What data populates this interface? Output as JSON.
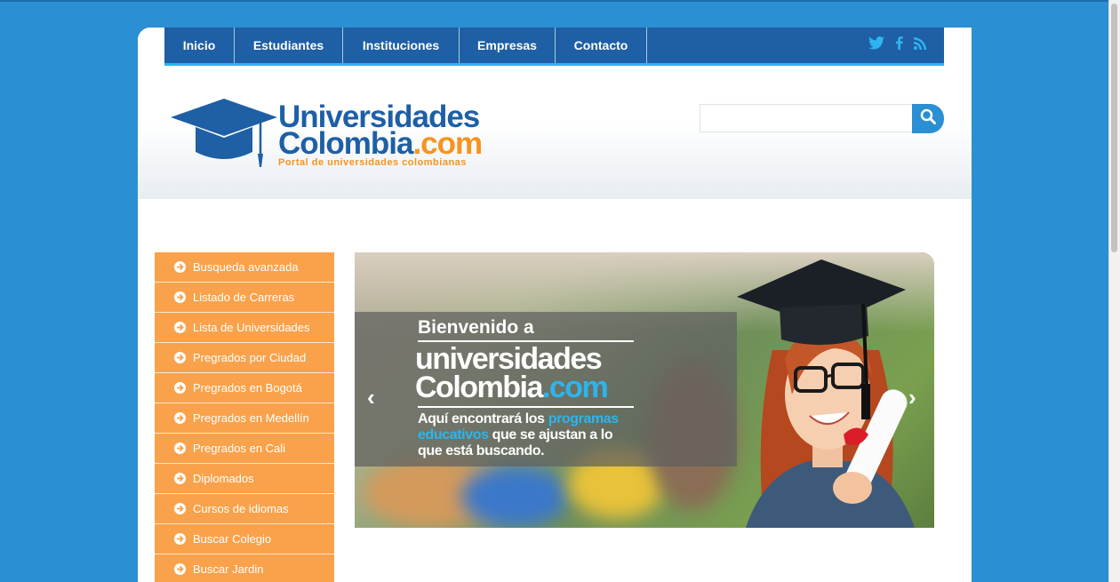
{
  "nav": {
    "items": [
      {
        "label": "Inicio"
      },
      {
        "label": "Estudiantes"
      },
      {
        "label": "Instituciones"
      },
      {
        "label": "Empresas"
      },
      {
        "label": "Contacto"
      }
    ],
    "social": [
      "twitter-icon",
      "facebook-icon",
      "rss-icon"
    ]
  },
  "logo": {
    "line1": "Universidades",
    "line2_main": "Colombia",
    "line2_domain": ".com",
    "tagline": "Portal de universidades colombianas"
  },
  "search": {
    "value": "",
    "placeholder": ""
  },
  "sidebar": {
    "items": [
      {
        "label": "Busqueda avanzada"
      },
      {
        "label": "Listado de Carreras"
      },
      {
        "label": "Lista de Universidades"
      },
      {
        "label": "Pregrados por Ciudad"
      },
      {
        "label": "Pregrados en Bogotá"
      },
      {
        "label": "Pregrados en Medellín"
      },
      {
        "label": "Pregrados en Cali"
      },
      {
        "label": "Diplomados"
      },
      {
        "label": "Cursos de idiomas"
      },
      {
        "label": "Buscar Colegio"
      },
      {
        "label": "Buscar Jardin"
      }
    ]
  },
  "slider": {
    "welcome": "Bienvenido a",
    "brand_line1": "universidades",
    "brand_line2_main": "Colombia",
    "brand_line2_domain": ".com",
    "desc_part1": "Aquí encontrará los ",
    "desc_highlight": "programas educativos",
    "desc_part2": " que se ajustan a lo que está buscando.",
    "prev": "‹",
    "next": "›"
  },
  "colors": {
    "background": "#2a8fd3",
    "nav": "#1e5fa5",
    "nav_accent": "#2cb5ee",
    "sidebar": "#f9a24b",
    "logo_orange": "#f7931e"
  }
}
